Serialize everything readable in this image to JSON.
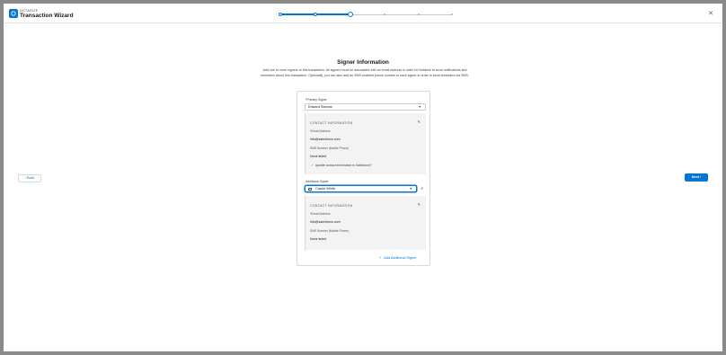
{
  "header": {
    "brand_small": "NOTARIZE",
    "brand_title": "Transaction Wizard",
    "close_icon": "close-icon"
  },
  "progress": {
    "total_steps": 6,
    "completed_steps": 2,
    "current_step": 3
  },
  "main": {
    "title": "Signer Information",
    "description": "Add one or more signers to this transaction. All signers must be associated with an email address in order for Notarize to send notifications and reminders about this transaction. Optionally, you can also add an SMS-enabled phone number to each signer in order to send reminders via SMS."
  },
  "primary": {
    "label": "Primary Signer",
    "value": "Edward Stamos",
    "contact": {
      "heading": "CONTACT INFORMATION",
      "email_label": "Email Address",
      "email_value": "info@salesforce.com",
      "sms_label": "SMS Number (Mobile Phone)",
      "sms_value": "None listed",
      "update_checkbox": "Update contact information in Salesforce?"
    }
  },
  "additional": {
    "label": "Additional Signer",
    "value": "Carole White",
    "contact": {
      "heading": "CONTACT INFORMATION",
      "email_label": "Email Address",
      "email_value": "info@salesforce.com",
      "sms_label": "SMS Number (Mobile Phone)",
      "sms_value": "None listed"
    }
  },
  "add_signer_label": "Add Additional Signer",
  "nav": {
    "back_label": "Back",
    "next_label": "Next"
  },
  "colors": {
    "brand": "#0176d3",
    "required": "#ba0517"
  }
}
